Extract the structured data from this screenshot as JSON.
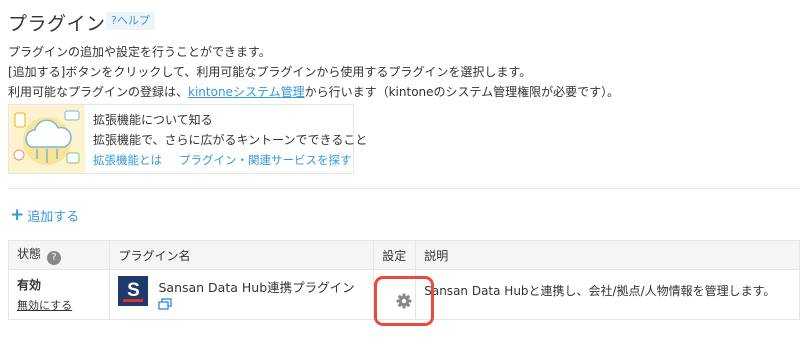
{
  "page": {
    "title": "プラグイン",
    "help_label": "?ヘルプ"
  },
  "description": {
    "line1": "プラグインの追加や設定を行うことができます。",
    "line2": "[追加する]ボタンをクリックして、利用可能なプラグインから使用するプラグインを選択します。",
    "line3_prefix": "利用可能なプラグインの登録は、",
    "line3_link": "kintoneシステム管理",
    "line3_suffix": "から行います（kintoneのシステム管理権限が必要です）。"
  },
  "banner": {
    "title": "拡張機能について知る",
    "subtitle": "拡張機能で、さらに広がるキントーンでできること",
    "link1": "拡張機能とは",
    "link2": "プラグイン・関連サービスを探す"
  },
  "add_button": {
    "label": "追加する"
  },
  "table": {
    "headers": {
      "status": "状態",
      "name": "プラグイン名",
      "settings": "設定",
      "description": "説明"
    },
    "rows": [
      {
        "status": "有効",
        "toggle_label": "無効にする",
        "logo_letter": "S",
        "name": "Sansan Data Hub連携プラグイン",
        "description": "Sansan Data Hubと連携し、会社/拠点/人物情報を管理します。"
      }
    ]
  },
  "colors": {
    "link": "#3498db",
    "highlight": "#e84b3c",
    "logo_bg": "#1f3b6e"
  }
}
